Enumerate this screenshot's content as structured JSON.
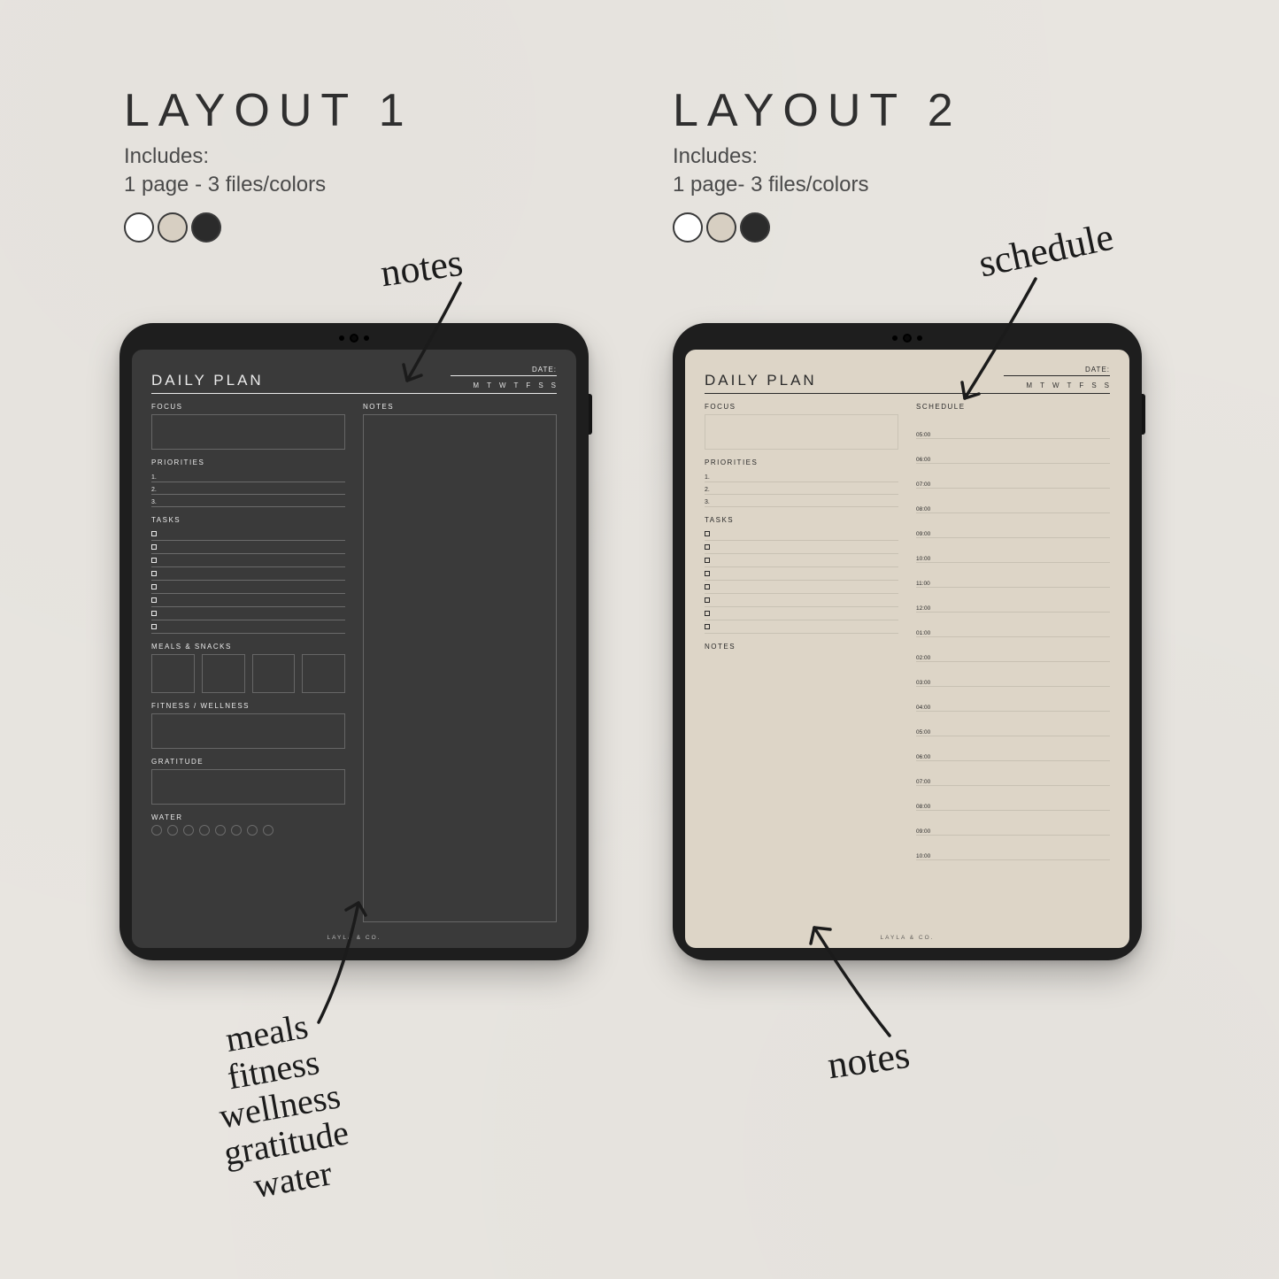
{
  "layout1": {
    "heading": "LAYOUT 1",
    "includes_label": "Includes:",
    "includes_detail": "1 page - 3 files/colors",
    "swatch_colors": [
      "#ffffff",
      "#d7cfc2",
      "#2b2b2b"
    ]
  },
  "layout2": {
    "heading": "LAYOUT 2",
    "includes_label": "Includes:",
    "includes_detail": "1 page- 3 files/colors",
    "swatch_colors": [
      "#ffffff",
      "#d7cfc2",
      "#2b2b2b"
    ]
  },
  "annotations": {
    "notes1": "notes",
    "schedule": "schedule",
    "notes2": "notes",
    "list": [
      "meals",
      "fitness",
      "wellness",
      "gratitude",
      "water"
    ]
  },
  "planner": {
    "title": "DAILY PLAN",
    "date_label": "DATE:",
    "days": [
      "M",
      "T",
      "W",
      "T",
      "F",
      "S",
      "S"
    ],
    "sections": {
      "focus": "FOCUS",
      "priorities": "PRIORITIES",
      "tasks": "TASKS",
      "meals": "MEALS & SNACKS",
      "fitness": "FITNESS / WELLNESS",
      "gratitude": "GRATITUDE",
      "water": "WATER",
      "notes": "NOTES",
      "schedule": "SCHEDULE"
    },
    "priority_numbers": [
      "1.",
      "2.",
      "3."
    ],
    "task_count": 8,
    "meal_box_count": 4,
    "water_count": 8,
    "schedule_times": [
      "05:00",
      "06:00",
      "07:00",
      "08:00",
      "09:00",
      "10:00",
      "11:00",
      "12:00",
      "01:00",
      "02:00",
      "03:00",
      "04:00",
      "05:00",
      "06:00",
      "07:00",
      "08:00",
      "09:00",
      "10:00"
    ],
    "brand": "LAYLA & CO."
  }
}
